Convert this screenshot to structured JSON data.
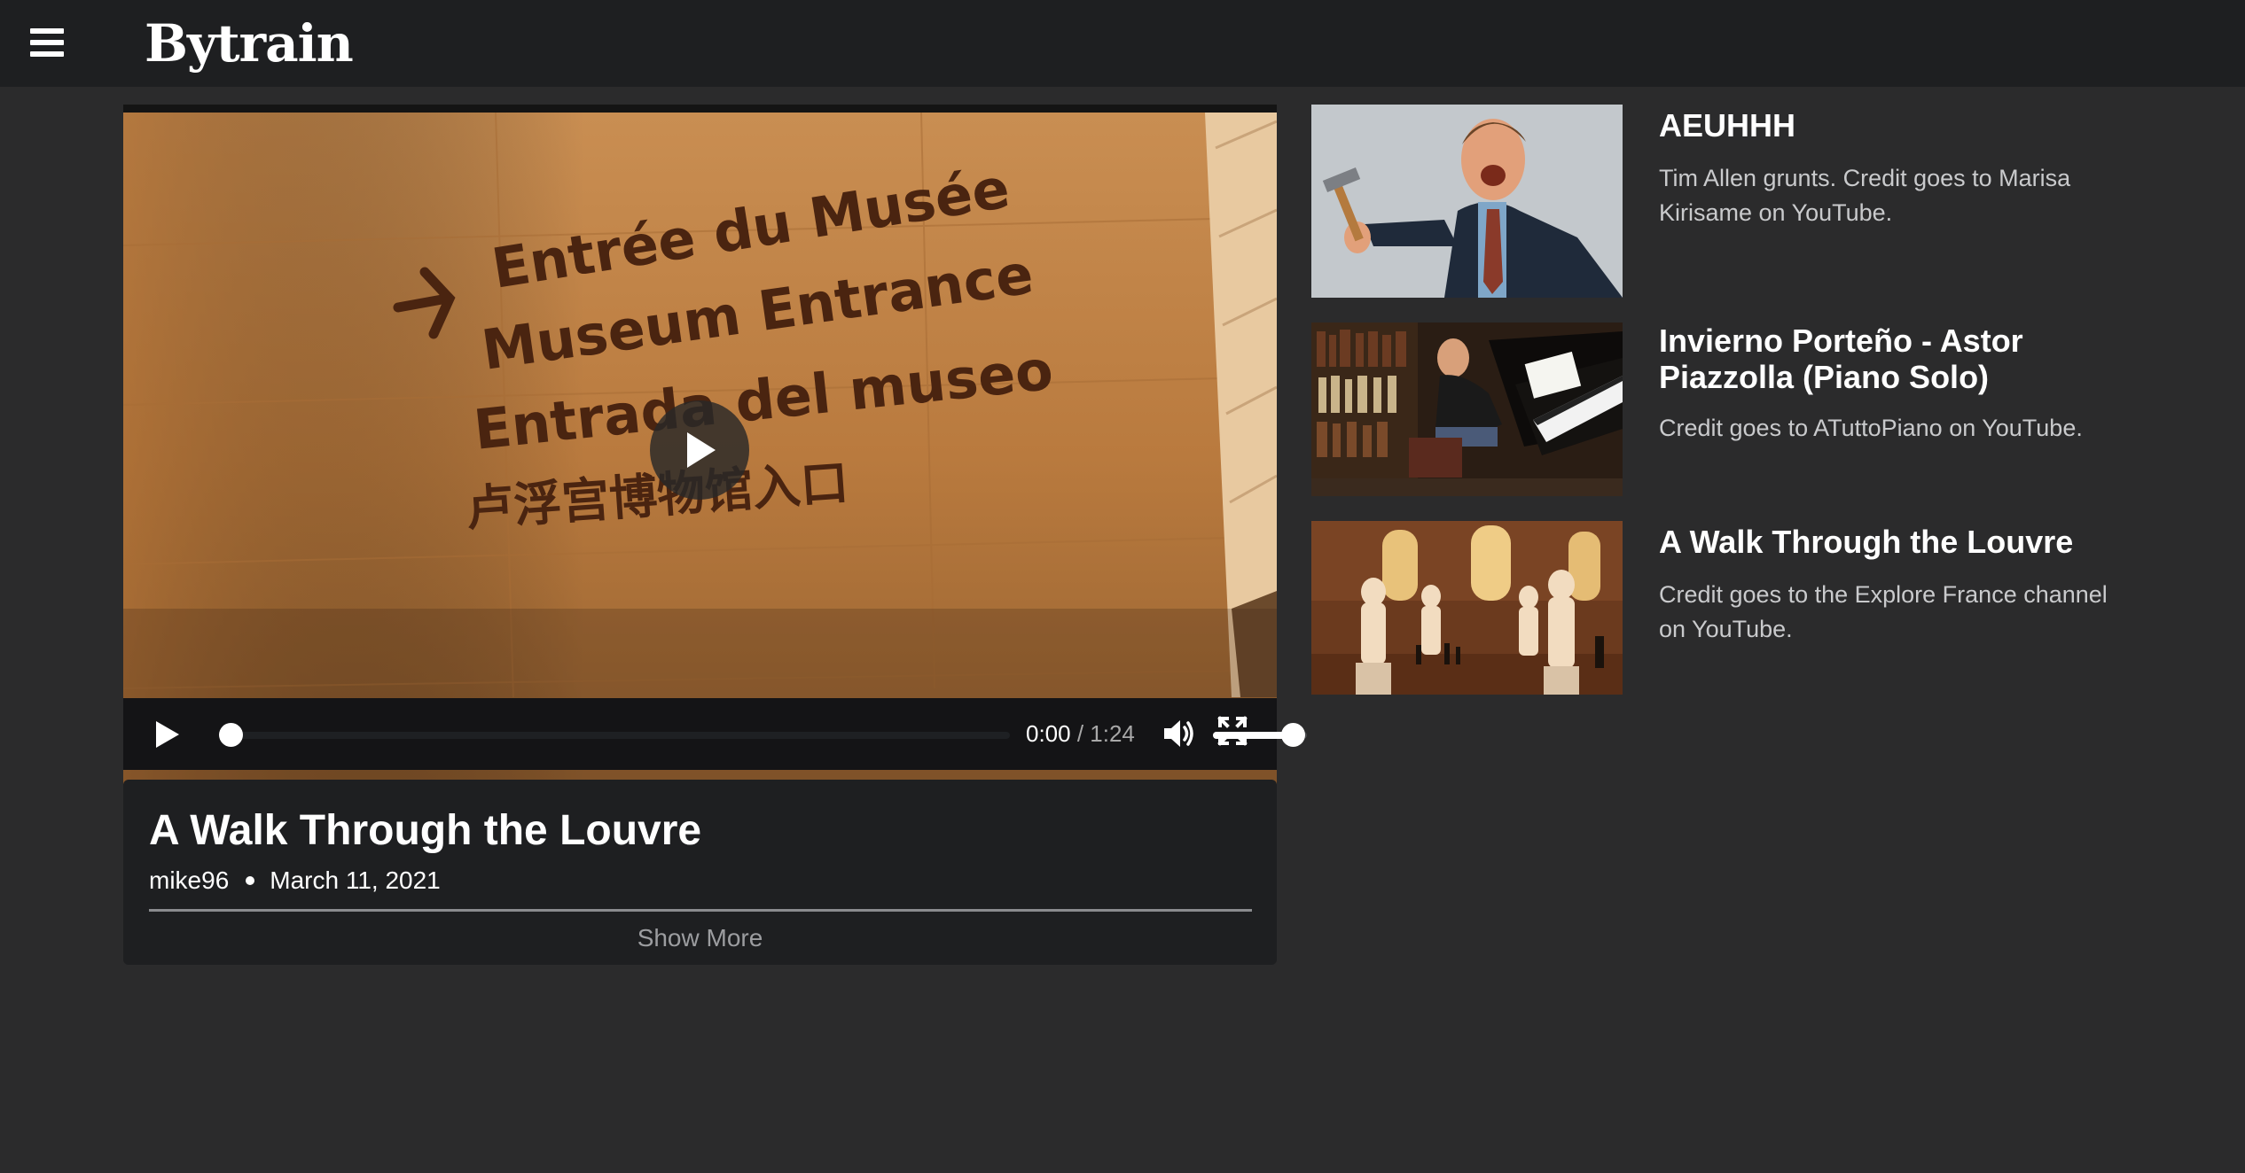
{
  "header": {
    "menu_icon": "hamburger-menu-icon",
    "brand": "Bytrain"
  },
  "player": {
    "video_sign_lines": [
      "Entrée du Musée",
      "Museum Entrance",
      "Entrada del museo",
      "卢浮宫博物馆入口"
    ],
    "current_time": "0:00",
    "separator": " / ",
    "duration": "1:24",
    "progress": 0,
    "volume": 0.85,
    "icons": {
      "big_play": "play-overlay-icon",
      "play": "play-icon",
      "volume": "volume-icon",
      "fullscreen": "fullscreen-icon"
    }
  },
  "video_info": {
    "title": "A Walk Through the Louvre",
    "author": "mike96",
    "date": "March 11, 2021",
    "show_more": "Show More"
  },
  "related": [
    {
      "title": "AEUHHH",
      "description": "Tim Allen grunts. Credit goes to Marisa Kirisame on YouTube."
    },
    {
      "title": "Invierno Porteño - Astor Piazzolla (Piano Solo)",
      "description": "Credit goes to ATuttoPiano on YouTube."
    },
    {
      "title": "A Walk Through the Louvre",
      "description": "Credit goes to the Explore France channel on YouTube."
    }
  ],
  "colors": {
    "page_background": "#2b2b2c",
    "header_background": "#1e1f21",
    "panel_background": "#1e1f21",
    "text_primary": "#ffffff",
    "text_secondary": "#c9cacc"
  }
}
